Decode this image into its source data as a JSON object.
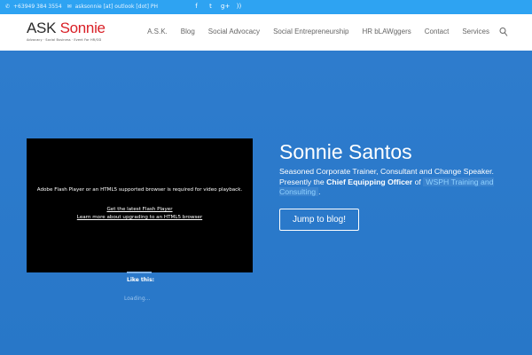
{
  "topbar": {
    "phone": "+63949 384 3554",
    "email": "asksonnie [at] outlook [dot] PH",
    "social": [
      {
        "icon": "facebook-icon",
        "glyph": "f"
      },
      {
        "icon": "twitter-icon",
        "glyph": "t"
      },
      {
        "icon": "google-plus-icon",
        "glyph": "g+"
      },
      {
        "icon": "rss-icon",
        "glyph": "))"
      }
    ],
    "color": "#2ea3f2"
  },
  "header": {
    "logo": {
      "ask": "ASK",
      "sonnie": "Sonnie",
      "tagline": "Advocacy · Social Business · Event For HR/OD"
    },
    "nav": [
      {
        "label": "A.S.K."
      },
      {
        "label": "Blog"
      },
      {
        "label": "Social Advocacy"
      },
      {
        "label": "Social Entrepreneurship"
      },
      {
        "label": "HR bLAWggers"
      },
      {
        "label": "Contact"
      },
      {
        "label": "Services"
      }
    ]
  },
  "video": {
    "message": "Adobe Flash Player or an HTML5 supported browser is required for video playback.",
    "link1": "Get the latest Flash Player",
    "link2": "Learn more about upgrading to an HTML5 browser"
  },
  "likes": {
    "title": "Like this:",
    "loading": "Loading..."
  },
  "hero": {
    "name": "Sonnie Santos",
    "bio_part1": "Seasoned Corporate Trainer, Consultant and Change Speaker. Presently the",
    "bio_role": "Chief Equipping Officer",
    "bio_of": "of",
    "bio_link": "WSPH Training and Consulting",
    "bio_end": ".",
    "button": "Jump to blog!",
    "background": "#2a78c9"
  }
}
